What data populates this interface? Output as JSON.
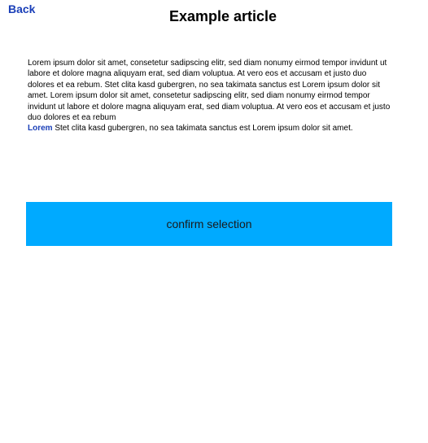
{
  "nav": {
    "back_label": "Back"
  },
  "article": {
    "title": "Example article",
    "paragraph": "Lorem ipsum dolor sit amet, consetetur sadipscing elitr, sed diam nonumy eirmod tempor invidunt ut labore et dolore magna aliquyam erat, sed diam voluptua. At vero eos et accusam et justo duo dolores et ea rebum. Stet clita kasd gubergren, no sea takimata sanctus est Lorem ipsum dolor sit amet. Lorem ipsum dolor sit amet, consetetur sadipscing elitr, sed diam nonumy eirmod tempor invidunt ut labore et dolore magna aliquyam erat, sed diam voluptua. At vero eos et accusam et justo duo dolores et ea rebum",
    "link_label": "Lorem",
    "trailing_text": " Stet clita kasd gubergren, no sea takimata sanctus est Lorem ipsum dolor sit amet."
  },
  "actions": {
    "confirm_label": "confirm selection"
  },
  "colors": {
    "link": "#1a3fb8",
    "button_background": "#00aaff",
    "page_background": "#ffffff"
  }
}
